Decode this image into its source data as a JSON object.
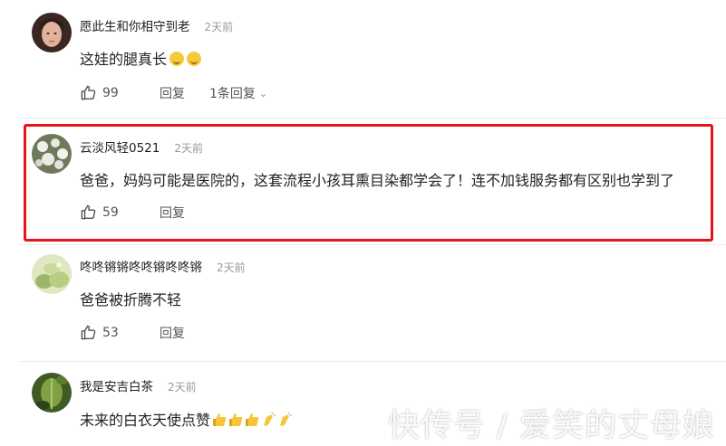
{
  "comments": [
    {
      "username": "愿此生和你相守到老",
      "time": "2天前",
      "text": "这娃的腿真长",
      "emoji_icons": [
        "grin-emoji",
        "grin-emoji"
      ],
      "likes": "99",
      "reply_label": "回复",
      "replies_label": "1条回复",
      "avatar_colors": [
        "#d8a48f",
        "#3a2622"
      ]
    },
    {
      "username": "云淡风轻0521",
      "time": "2天前",
      "text": "爸爸，妈妈可能是医院的，这套流程小孩耳熏目染都学会了！连不加钱服务都有区别也学到了",
      "likes": "59",
      "reply_label": "回复",
      "highlighted": true,
      "highlight_color": "#e8121b",
      "avatar_colors": [
        "#7d8568",
        "#e9e9e2"
      ]
    },
    {
      "username": "咚咚锵锵咚咚锵咚咚锵",
      "time": "2天前",
      "text": "爸爸被折腾不轻",
      "likes": "53",
      "reply_label": "回复",
      "avatar_colors": [
        "#c8d79a",
        "#8fa868"
      ]
    },
    {
      "username": "我是安吉白茶",
      "time": "2天前",
      "text": "未来的白衣天使点赞",
      "emoji_icons": [
        "thumbs-up-emoji",
        "thumbs-up-emoji",
        "thumbs-up-emoji",
        "clap-emoji",
        "clap-emoji"
      ],
      "avatar_colors": [
        "#4e6a2c",
        "#9fbf5b"
      ]
    }
  ],
  "watermark": "快传号 / 爱笑的丈母娘"
}
